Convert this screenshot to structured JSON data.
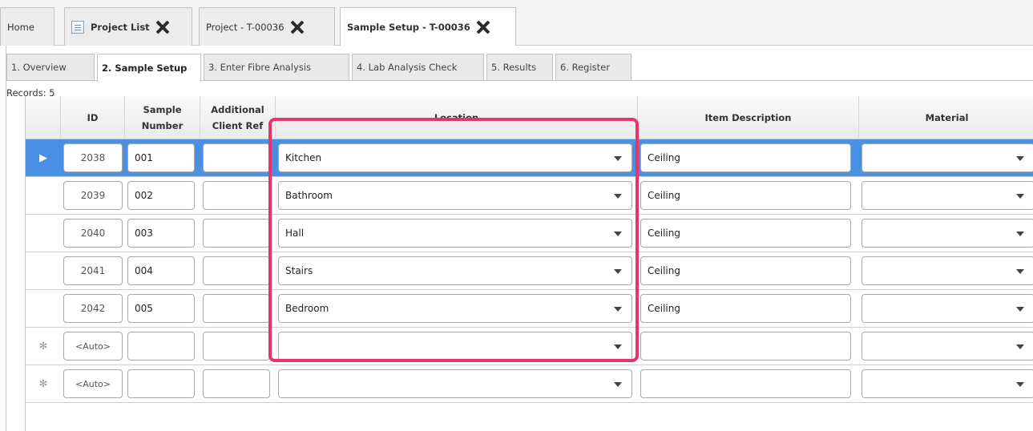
{
  "top_tabs": [
    {
      "label": "Home"
    },
    {
      "label": "Project List",
      "icon": "document-list-icon"
    },
    {
      "label": "Project - T-00036"
    },
    {
      "label": "Sample Setup - T-00036"
    }
  ],
  "sub_tabs": [
    {
      "label": "1. Overview"
    },
    {
      "label": "2. Sample Setup"
    },
    {
      "label": "3. Enter Fibre Analysis"
    },
    {
      "label": "4. Lab Analysis Check"
    },
    {
      "label": "5. Results"
    },
    {
      "label": "6. Register"
    }
  ],
  "records_label": "Records: 5",
  "columns": {
    "id": "ID",
    "sample_number_1": "Sample",
    "sample_number_2": "Number",
    "client_ref_1": "Additional",
    "client_ref_2": "Client Ref",
    "location": "Location",
    "item_description": "Item Description",
    "material": "Material"
  },
  "rows": [
    {
      "id": "2038",
      "sample": "001",
      "client_ref": "",
      "location": "Kitchen",
      "item": "Ceiling",
      "material": "",
      "selected": true
    },
    {
      "id": "2039",
      "sample": "002",
      "client_ref": "",
      "location": "Bathroom",
      "item": "Ceiling",
      "material": ""
    },
    {
      "id": "2040",
      "sample": "003",
      "client_ref": "",
      "location": "Hall",
      "item": "Ceiling",
      "material": ""
    },
    {
      "id": "2041",
      "sample": "004",
      "client_ref": "",
      "location": "Stairs",
      "item": "Ceiling",
      "material": ""
    },
    {
      "id": "2042",
      "sample": "005",
      "client_ref": "",
      "location": "Bedroom",
      "item": "Ceiling",
      "material": ""
    }
  ],
  "new_rows": [
    {
      "marker": "✻",
      "id": "<Auto>"
    },
    {
      "marker": "✻",
      "id": "<Auto>"
    }
  ],
  "selected_row_marker": "▶",
  "colors": {
    "selected_row": "#4a90e2",
    "highlight_box": "#e8346a"
  }
}
